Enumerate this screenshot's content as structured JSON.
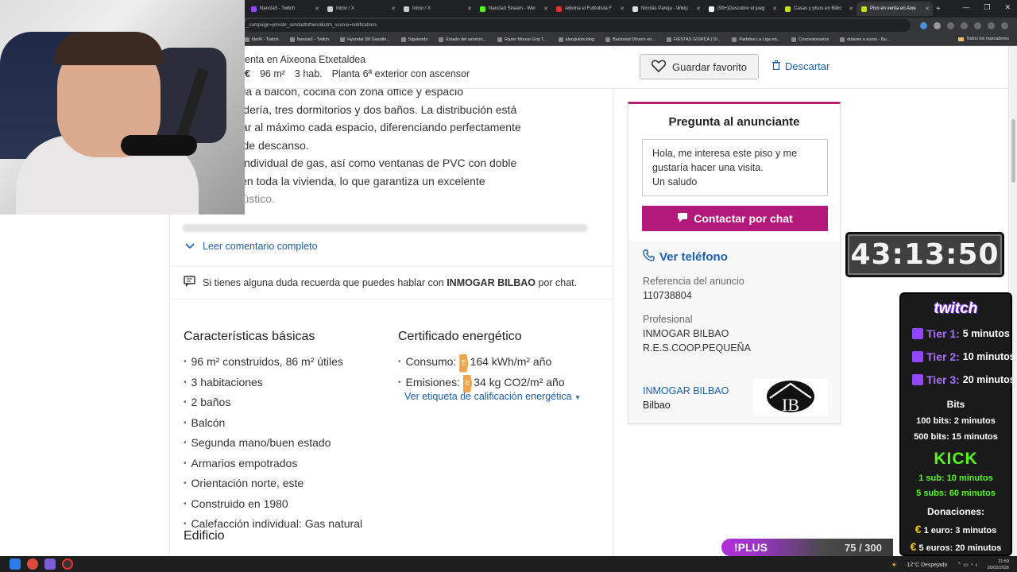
{
  "browser": {
    "tabs": [
      {
        "label": "Nancla3 - Twitch",
        "color": "#9146ff",
        "active": false
      },
      {
        "label": "Inicio / X",
        "color": "#cccccc",
        "active": false
      },
      {
        "label": "Inicio / X",
        "color": "#cccccc",
        "active": false
      },
      {
        "label": "Nancla3 Stream - Wei",
        "color": "#53fc18",
        "active": false
      },
      {
        "label": "Adivina el Futbolista F",
        "color": "#e03030",
        "active": false
      },
      {
        "label": "Nicolás Pareja - Wikip",
        "color": "#dddddd",
        "active": false
      },
      {
        "label": "(99+)Descubre el jueg",
        "color": "#ffffff",
        "active": false
      },
      {
        "label": "Casas y pisos en Bilbc",
        "color": "#c5e01a",
        "active": false
      },
      {
        "label": "Piso en venta en Aixe",
        "color": "#c5e01a",
        "active": true
      }
    ],
    "url": "_campaign=private_sendadtofriend&utm_source=notifications",
    "bookmarks": [
      "lderR - Twitch",
      "Nancla3 - Twitch",
      "Hyundai i30 Gasolin...",
      "Siguiendo",
      "Estado del servicio...",
      "Razer Mouse Grip T...",
      "alangulotv.blog",
      "Backseat Drivers en...",
      "FIESTAS GUIRCA | Di...",
      "Partidos La Liga en...",
      "Concesionarios",
      "dolares a euros - Bu..."
    ],
    "bookmarks_all": "Todos los marcadores"
  },
  "listing": {
    "title": "enta en Aixeona Etxetaldea",
    "price_suffix": "€",
    "size": "96 m²",
    "rooms": "3 hab.",
    "floor": "Planta 6ª exterior con ascensor",
    "favorite_label": "Guardar favorito",
    "discard_label": "Descartar"
  },
  "description": {
    "lines": [
      "dor con salida a balcón, cocina con zona office y espacio",
      "nte de lavandería, tres dormitorios y dos baños. La distribución está",
      "ra aprovechar al máximo cada espacio, diferenciando perfectamente",
      "ía y la zona de descanso.",
      "calefacción individual de gas, así como ventanas de PVC con doble",
      "nto Climalit en toda la vivienda, lo que garantiza un excelente",
      "térmico y acústico."
    ],
    "read_more": "Leer comentario completo"
  },
  "chat_note": {
    "prefix": "Si tienes alguna duda recuerda que puedes hablar con",
    "agency": "INMOGAR BILBAO",
    "suffix": "por chat."
  },
  "features": {
    "title": "Características básicas",
    "items": [
      "96 m² construidos, 86 m² útiles",
      "3 habitaciones",
      "2 baños",
      "Balcón",
      "Segunda mano/buen estado",
      "Armarios empotrados",
      "Orientación norte, este",
      "Construido en 1980",
      "Calefacción individual: Gas natural"
    ]
  },
  "energy": {
    "title": "Certificado energético",
    "consumo_label": "Consumo:",
    "consumo_grade": "E",
    "consumo_value": "164 kWh/m² año",
    "emisiones_label": "Emisiones:",
    "emisiones_grade": "E",
    "emisiones_value": "34 kg CO2/m² año",
    "link": "Ver etiqueta de calificación energética"
  },
  "building_title": "Edificio",
  "contact": {
    "title": "Pregunta al anunciante",
    "message": "Hola, me interesa este piso y me gustaría hacer una visita.\nUn saludo",
    "chat_button": "Contactar por chat",
    "phone_label": "Ver teléfono",
    "ref_label": "Referencia del anuncio",
    "ref_value": "110738804",
    "pro_label": "Profesional",
    "pro_name1": "INMOGAR BILBAO",
    "pro_name2": "R.E.S.COOP.PEQUEÑA",
    "agency_link": "INMOGAR BILBAO",
    "agency_city": "Bilbao"
  },
  "stream": {
    "timer": "43:13:50",
    "twitch_logo": "twitch",
    "tiers": [
      {
        "name": "Tier 1:",
        "value": "5 minutos"
      },
      {
        "name": "Tier 2:",
        "value": "10 minutos"
      },
      {
        "name": "Tier 3:",
        "value": "20 minutos"
      }
    ],
    "bits_title": "Bits",
    "bits": [
      "100 bits: 2 minutos",
      "500 bits: 15 minutos"
    ],
    "kick_logo": "KICK",
    "kick": [
      "1 sub: 10 minutos",
      "5 subs: 60 minutos"
    ],
    "donations_title": "Donaciones:",
    "donations": [
      "1 euro: 3 minutos",
      "5 euros: 20 minutos"
    ],
    "plus_label": "!PLUS",
    "plus_count": "75 / 300"
  },
  "taskbar": {
    "weather": "12°C Despejado",
    "time": "21:59",
    "date": "26/02/2026"
  }
}
